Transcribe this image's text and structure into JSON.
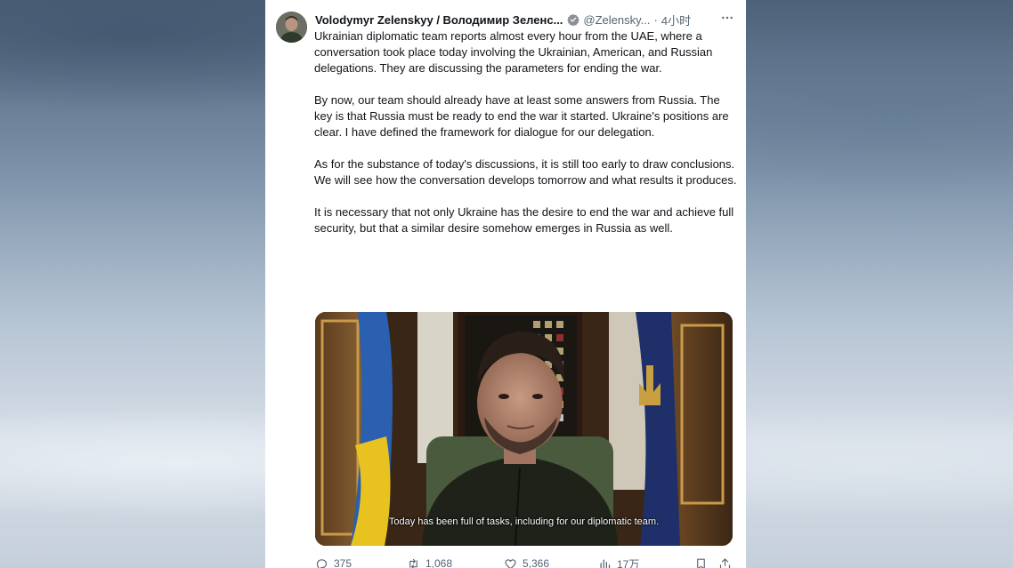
{
  "tweet": {
    "display_name": "Volodymyr Zelenskyy / Володимир Зеленс...",
    "handle": "@Zelensky...",
    "separator": "·",
    "time": "4小时",
    "verified_icon": "verified-badge-icon",
    "paragraphs": [
      "Ukrainian diplomatic team reports almost every hour from the UAE, where a conversation took place today involving the Ukrainian, American, and Russian delegations. They are discussing the parameters for ending the war.",
      "By now, our team should already have at least some answers from Russia. The key is that Russia must be ready to end the war it started. Ukraine's positions are clear. I have defined the framework for dialogue for our delegation.",
      "As for the substance of today's discussions, it is still too early to draw conclusions. We will see how the conversation develops tomorrow and what results it produces.",
      "It is necessary that not only Ukraine has the desire to end the war and achieve full security, but that a similar desire somehow emerges in Russia as well."
    ],
    "video_subtitle": "Today has been full of tasks, including for our diplomatic team."
  },
  "actions": {
    "replies": "375",
    "retweets": "1,068",
    "likes": "5,366",
    "views": "17万"
  },
  "colors": {
    "accent": "#1d9bf0",
    "text": "#0f1419",
    "muted": "#536471"
  }
}
